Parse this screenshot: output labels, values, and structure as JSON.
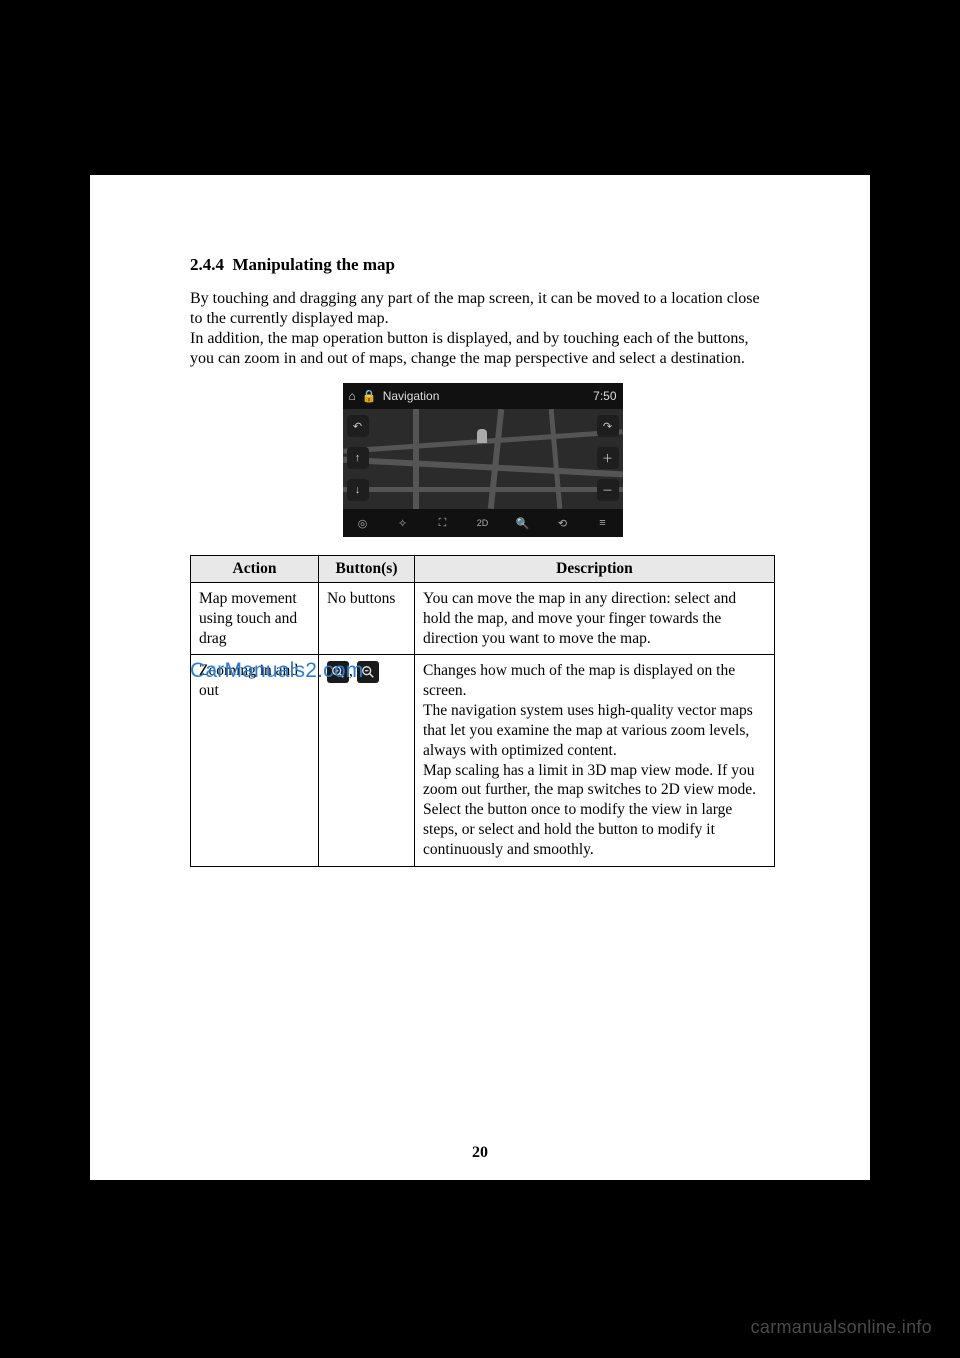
{
  "section": {
    "number": "2.4.4",
    "title": "Manipulating the map"
  },
  "intro": "By touching and dragging any part of the map screen, it can be moved to a location close to the currently displayed map.\nIn addition, the map operation button is displayed, and by touching each of the buttons, you can zoom in and out of maps, change the map perspective and select a destination.",
  "figure": {
    "title": "Navigation",
    "clock": "7:50"
  },
  "table": {
    "headers": {
      "action": "Action",
      "buttons": "Button(s)",
      "description": "Description"
    },
    "rows": [
      {
        "action": "Map movement using touch and drag",
        "buttons_text": "No buttons",
        "buttons_type": "text",
        "description": "You can move the map in any direction: select and hold the map, and move your finger towards the direction you want to move the map."
      },
      {
        "action": "Zooming in and out",
        "buttons_type": "zoom_icons",
        "description": "Changes how much of the map is displayed on the screen.\nThe navigation system uses high-quality vector maps that let you examine the map at various zoom levels, always with optimized content.\nMap scaling has a limit in 3D map view mode. If you zoom out further, the map switches to 2D view mode.\nSelect the button once to modify the view in large steps, or select and hold the button to modify it continuously and smoothly."
      }
    ]
  },
  "watermark": "CarManuals2.com",
  "page_number": "20",
  "footer_brand": "carmanualsonline.info"
}
